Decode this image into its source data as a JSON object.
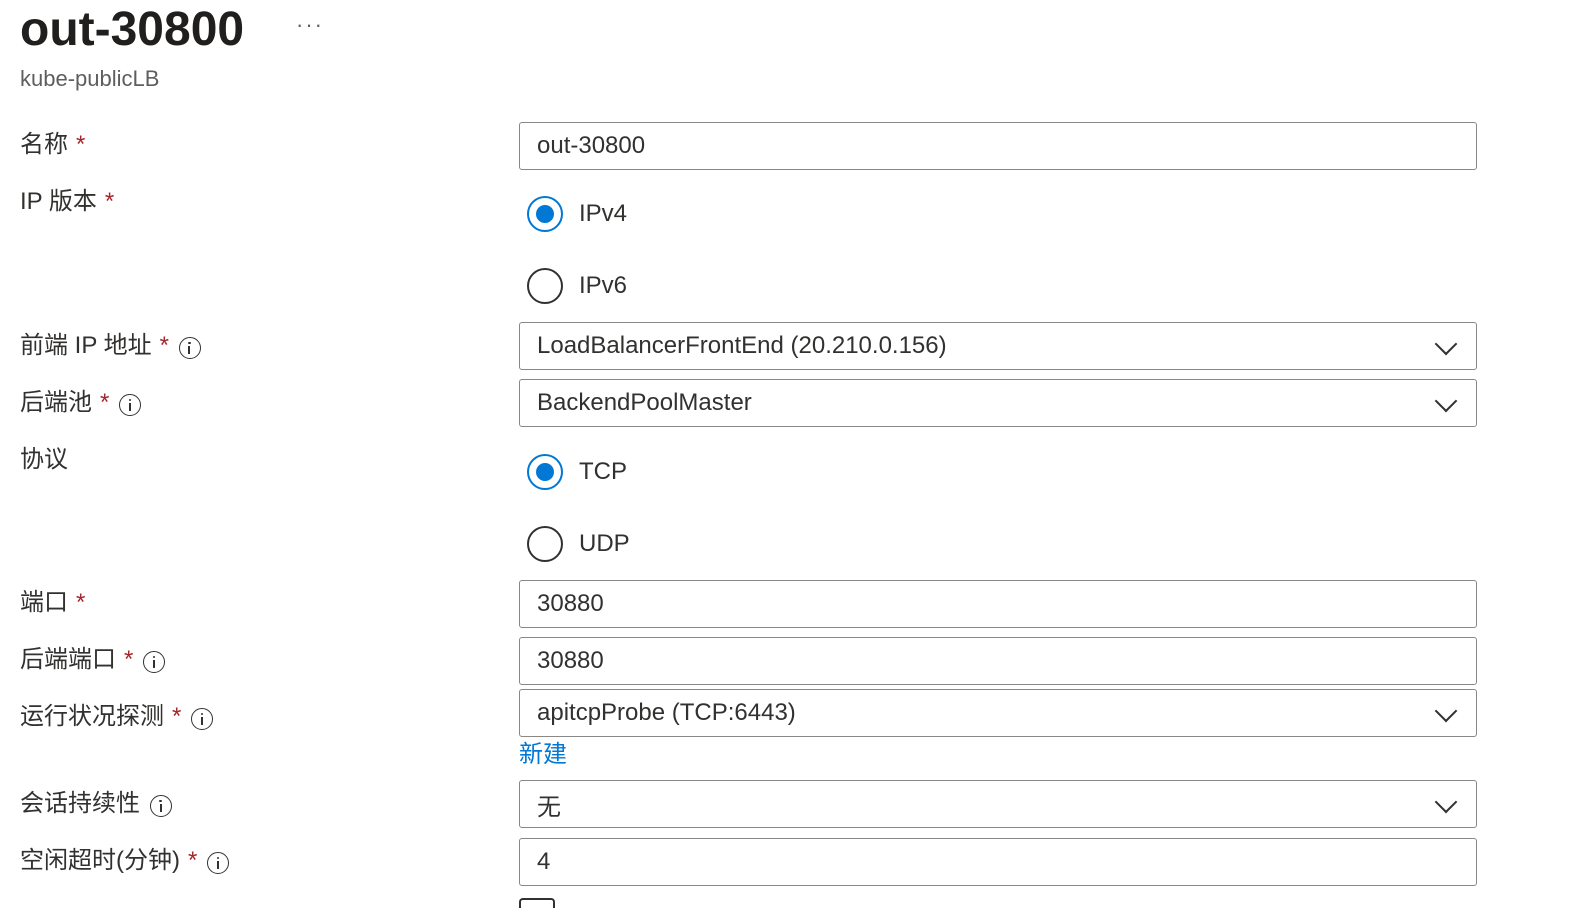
{
  "header": {
    "title": "out-30800",
    "more": "···",
    "subtitle": "kube-publicLB"
  },
  "form": {
    "name": {
      "label": "名称",
      "required": "*",
      "value": "out-30800"
    },
    "ip_version": {
      "label": "IP 版本",
      "required": "*",
      "options": [
        {
          "label": "IPv4",
          "checked": true
        },
        {
          "label": "IPv6",
          "checked": false
        }
      ]
    },
    "frontend_ip": {
      "label": "前端 IP 地址",
      "required": "*",
      "value": "LoadBalancerFrontEnd (20.210.0.156)",
      "icon": "info-icon"
    },
    "backend_pool": {
      "label": "后端池",
      "required": "*",
      "value": "BackendPoolMaster",
      "icon": "info-icon"
    },
    "protocol": {
      "label": "协议",
      "options": [
        {
          "label": "TCP",
          "checked": true
        },
        {
          "label": "UDP",
          "checked": false
        }
      ]
    },
    "port": {
      "label": "端口",
      "required": "*",
      "value": "30880"
    },
    "backend_port": {
      "label": "后端端口",
      "required": "*",
      "value": "30880",
      "icon": "info-icon"
    },
    "health_probe": {
      "label": "运行状况探测",
      "required": "*",
      "value": "apitcpProbe (TCP:6443)",
      "icon": "info-icon",
      "new_link": "新建"
    },
    "session_persistence": {
      "label": "会话持续性",
      "value": "无",
      "icon": "info-icon"
    },
    "idle_timeout": {
      "label": "空闲超时(分钟)",
      "required": "*",
      "value": "4",
      "icon": "info-icon"
    }
  },
  "colors": {
    "accent": "#0078d4",
    "required": "#a4262c",
    "border": "#8a8886",
    "text": "#323130"
  }
}
